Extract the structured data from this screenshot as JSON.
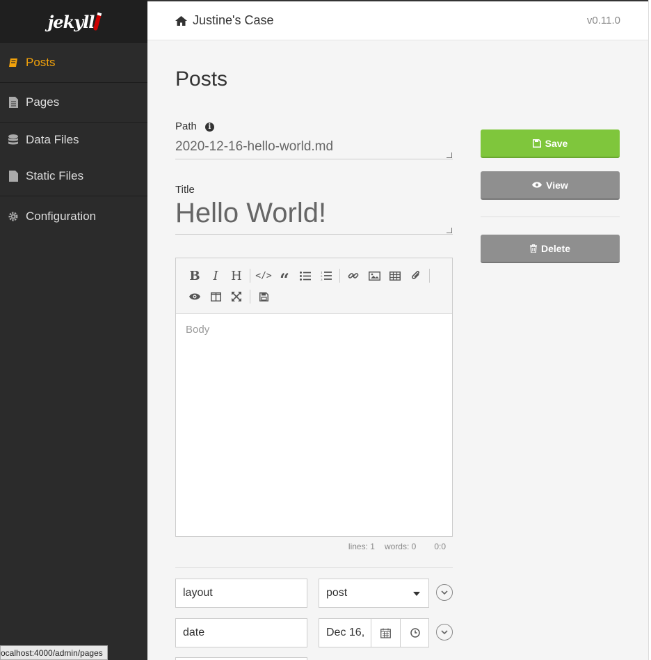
{
  "sidebar": {
    "logo": "jekyll",
    "items": [
      {
        "label": "Posts",
        "icon": "book-icon"
      },
      {
        "label": "Pages",
        "icon": "file-icon"
      },
      {
        "label": "Data Files",
        "icon": "database-icon"
      },
      {
        "label": "Static Files",
        "icon": "file-icon"
      },
      {
        "label": "Configuration",
        "icon": "gear-icon"
      }
    ]
  },
  "header": {
    "site_title": "Justine's Case",
    "version": "v0.11.0"
  },
  "main": {
    "page_title": "Posts",
    "path_label": "Path",
    "path_value": "2020-12-16-hello-world.md",
    "title_label": "Title",
    "title_value": "Hello World!",
    "body_placeholder": "Body",
    "status": {
      "lines": "lines: 1",
      "words": "words: 0",
      "cursor": "0:0"
    }
  },
  "toolbar_buttons": [
    "bold",
    "italic",
    "heading",
    "code",
    "quote",
    "unordered-list",
    "ordered-list",
    "link",
    "image",
    "table",
    "attachment",
    "preview",
    "side-by-side",
    "fullscreen",
    "save"
  ],
  "fields": [
    {
      "key": "layout",
      "value": "post"
    },
    {
      "key": "date",
      "value": "Dec 16,"
    }
  ],
  "actions": {
    "save": "Save",
    "view": "View",
    "delete": "Delete"
  },
  "url_tooltip": "ocalhost:4000/admin/pages",
  "colors": {
    "accent": "#f2a20b",
    "save": "#7fc63c",
    "neutral": "#8f8f8f",
    "sidebar": "#2b2b2b"
  }
}
